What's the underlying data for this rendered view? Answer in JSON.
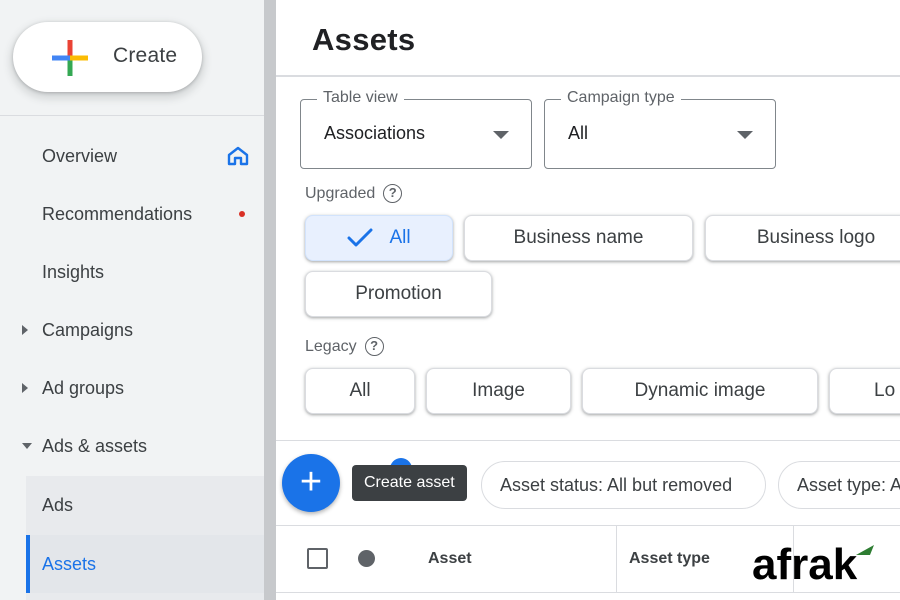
{
  "sidebar": {
    "create_label": "Create",
    "items": [
      {
        "label": "Overview",
        "icon": "home-icon"
      },
      {
        "label": "Recommendations",
        "badge": "red-dot"
      },
      {
        "label": "Insights"
      },
      {
        "label": "Campaigns",
        "expand": "collapsed"
      },
      {
        "label": "Ad groups",
        "expand": "collapsed"
      },
      {
        "label": "Ads & assets",
        "expand": "expanded"
      },
      {
        "label": "Ads"
      },
      {
        "label": "Assets",
        "selected": true
      }
    ]
  },
  "main": {
    "title": "Assets",
    "table_view": {
      "label": "Table view",
      "value": "Associations"
    },
    "campaign_type": {
      "label": "Campaign type",
      "value": "All"
    },
    "upgraded": {
      "label": "Upgraded",
      "chips": [
        "All",
        "Business name",
        "Business logo",
        "Promotion"
      ],
      "selected": "All"
    },
    "legacy": {
      "label": "Legacy",
      "chips": [
        "All",
        "Image",
        "Dynamic image",
        "Lo"
      ]
    },
    "fab_tooltip": "Create asset",
    "filters": [
      "Asset status: All but removed",
      "Asset type: A"
    ],
    "table": {
      "columns": [
        "Asset",
        "Asset type"
      ]
    }
  },
  "watermark": "afrak",
  "colors": {
    "accent": "#1a73e8",
    "sidebar_bg": "#f1f3f4",
    "selected_chip_bg": "#e8f0fe",
    "badge_red": "#d93025"
  }
}
